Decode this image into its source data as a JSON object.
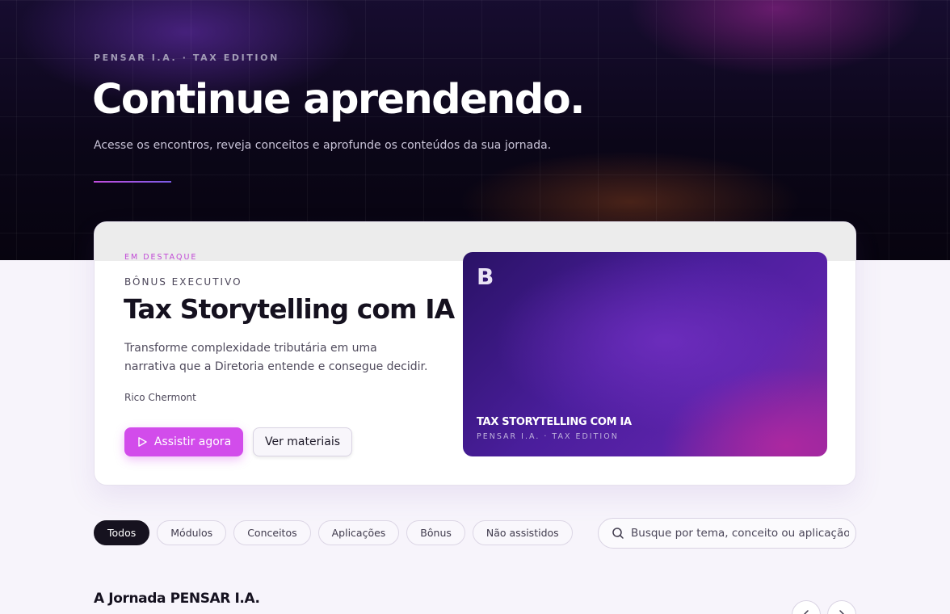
{
  "hero": {
    "eyebrow": "PENSAR I.A. · TAX EDITION",
    "title": "Continue aprendendo.",
    "subtitle": "Acesse os encontros, reveja conceitos e aprofunde os conteúdos da sua jornada."
  },
  "featured": {
    "badge": "EM DESTAQUE",
    "kicker": "BÔNUS EXECUTIVO",
    "title": "Tax Storytelling com IA",
    "description": "Transforme complexidade tributária em uma narrativa que a Diretoria entende e consegue decidir.",
    "author": "Rico Chermont",
    "primary_button": "Assistir agora",
    "secondary_button": "Ver materiais",
    "thumbnail": {
      "letter": "B",
      "title": "TAX STORYTELLING COM IA",
      "subtitle": "PENSAR I.A. · TAX EDITION"
    }
  },
  "filters": {
    "chips": [
      "Todos",
      "Módulos",
      "Conceitos",
      "Aplicações",
      "Bônus",
      "Não assistidos"
    ],
    "active": "Todos"
  },
  "search": {
    "placeholder": "Busque por tema, conceito ou aplicação"
  },
  "section": {
    "title": "A Jornada PENSAR I.A."
  },
  "colors": {
    "accent": "#d24ceb",
    "hero_bg": "#0b0618",
    "active_chip": "#16121f"
  },
  "icons": {
    "play": "play-icon",
    "search": "search-icon",
    "prev": "chevron-left-icon",
    "next": "chevron-right-icon"
  }
}
